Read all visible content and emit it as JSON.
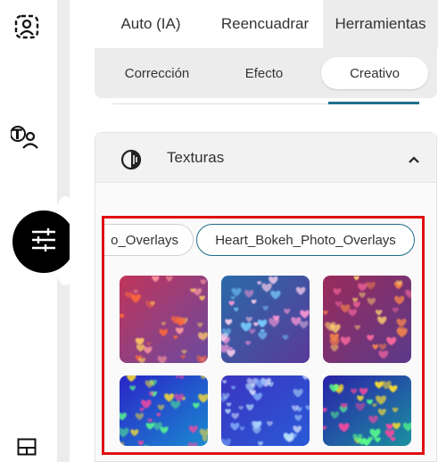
{
  "tabs": {
    "auto": "Auto (IA)",
    "reencuadrar": "Reencuadrar",
    "herramientas": "Herramientas"
  },
  "subtabs": {
    "correccion": "Corrección",
    "efecto": "Efecto",
    "creativo": "Creativo"
  },
  "section": {
    "title": "Texturas"
  },
  "chips": {
    "prev": "o_Overlays",
    "selected": "Heart_Bokeh_Photo_Overlays"
  },
  "thumbnails": [
    {
      "palette": [
        "#c0345a",
        "#6a4aa0"
      ],
      "spots": [
        "#ff6a3a",
        "#ffd060",
        "#ff9aa0"
      ]
    },
    {
      "palette": [
        "#2a6aa8",
        "#5a3a9a"
      ],
      "spots": [
        "#ff9ad8",
        "#ffd2ef",
        "#7ad0ff"
      ]
    },
    {
      "palette": [
        "#9a2a5a",
        "#5a3a8a"
      ],
      "spots": [
        "#ff8a4a",
        "#ffd070",
        "#ff6aa0"
      ]
    },
    {
      "palette": [
        "#2a24c8",
        "#1a8ad0"
      ],
      "spots": [
        "#ffe030",
        "#ff4aa0",
        "#5aff8a"
      ]
    },
    {
      "palette": [
        "#3a34c0",
        "#2a5ad8"
      ],
      "spots": [
        "#bfe8ff",
        "#e0e8ff",
        "#8ab8ff"
      ]
    },
    {
      "palette": [
        "#2a20a8",
        "#1a90a0"
      ],
      "spots": [
        "#ffe030",
        "#ff4aa0",
        "#5aff8a"
      ]
    }
  ],
  "icons": {
    "rail_top": "portrait-frame-icon",
    "rail_text_person": "text-person-icon",
    "rail_active": "sliders-icon",
    "rail_bottom": "layout-icon",
    "section": "contrast-icon",
    "chevron": "chevron-up-icon"
  },
  "colors": {
    "accent": "#1f6f8b",
    "highlight": "#e01010",
    "panel_bg": "#ececec"
  }
}
